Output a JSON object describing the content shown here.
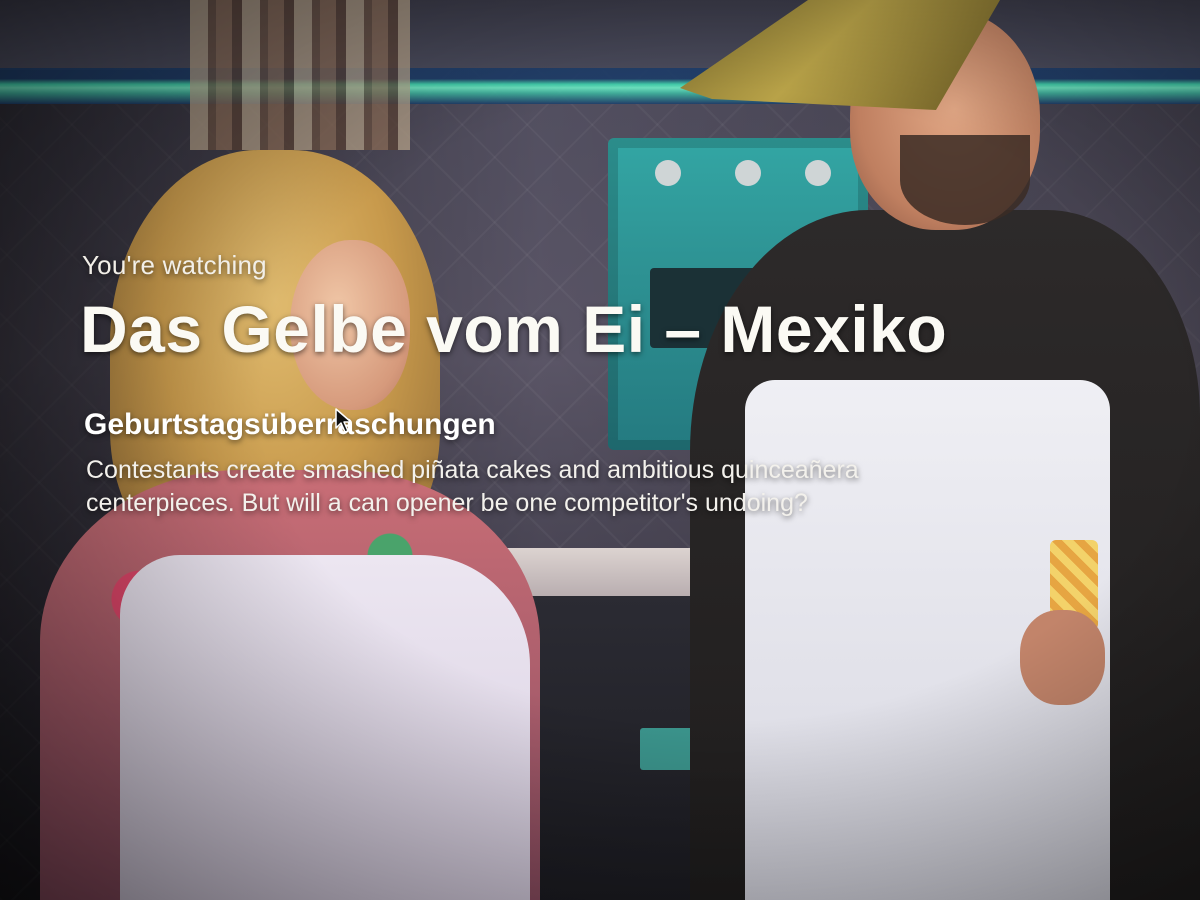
{
  "player": {
    "eyebrow": "You're watching",
    "show_title": "Das Gelbe vom Ei – Mexiko",
    "episode_title": "Geburtstagsüberraschungen",
    "episode_description": "Contestants create smashed piñata cakes and ambitious quinceañera centerpieces. But will a can opener be one competitor's undoing?"
  },
  "colors": {
    "text_primary": "#ffffff",
    "neon_accent": "#3fd7b0",
    "oven": "#2e9394"
  },
  "icons": {
    "pointer": "mouse-pointer-icon"
  }
}
